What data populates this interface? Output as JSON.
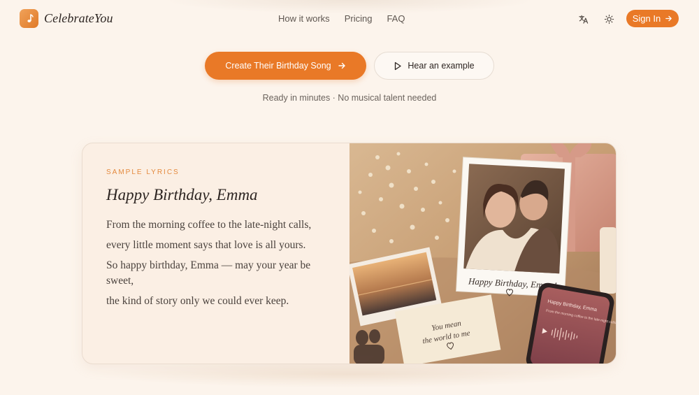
{
  "brand": {
    "name": "CelebrateYou"
  },
  "nav": {
    "links": [
      {
        "label": "How it works"
      },
      {
        "label": "Pricing"
      },
      {
        "label": "FAQ"
      }
    ],
    "translate_icon": "translate-icon",
    "theme_icon": "sun-icon",
    "sign_in_label": "Sign In"
  },
  "hero": {
    "primary_cta": "Create Their Birthday Song",
    "secondary_cta": "Hear an example",
    "tagline": "Ready in minutes · No musical talent needed"
  },
  "sample": {
    "label": "SAMPLE LYRICS",
    "title": "Happy Birthday, Emma",
    "lines": [
      "From the morning coffee to the late-night calls,",
      "every little moment says that love is all yours.",
      "So happy birthday, Emma — may your year be sweet,",
      "the kind of story only we could ever keep."
    ]
  },
  "photo": {
    "polaroid_caption": "Happy Birthday, Emma!",
    "card_note_line1": "You mean",
    "card_note_line2": "the world to me",
    "phone_title": "Happy Birthday, Emma",
    "phone_lyric": "From the morning coffee to the late-night calls..."
  },
  "colors": {
    "accent": "#e97927",
    "background": "#fcf4ec",
    "label": "#e48a3e"
  }
}
